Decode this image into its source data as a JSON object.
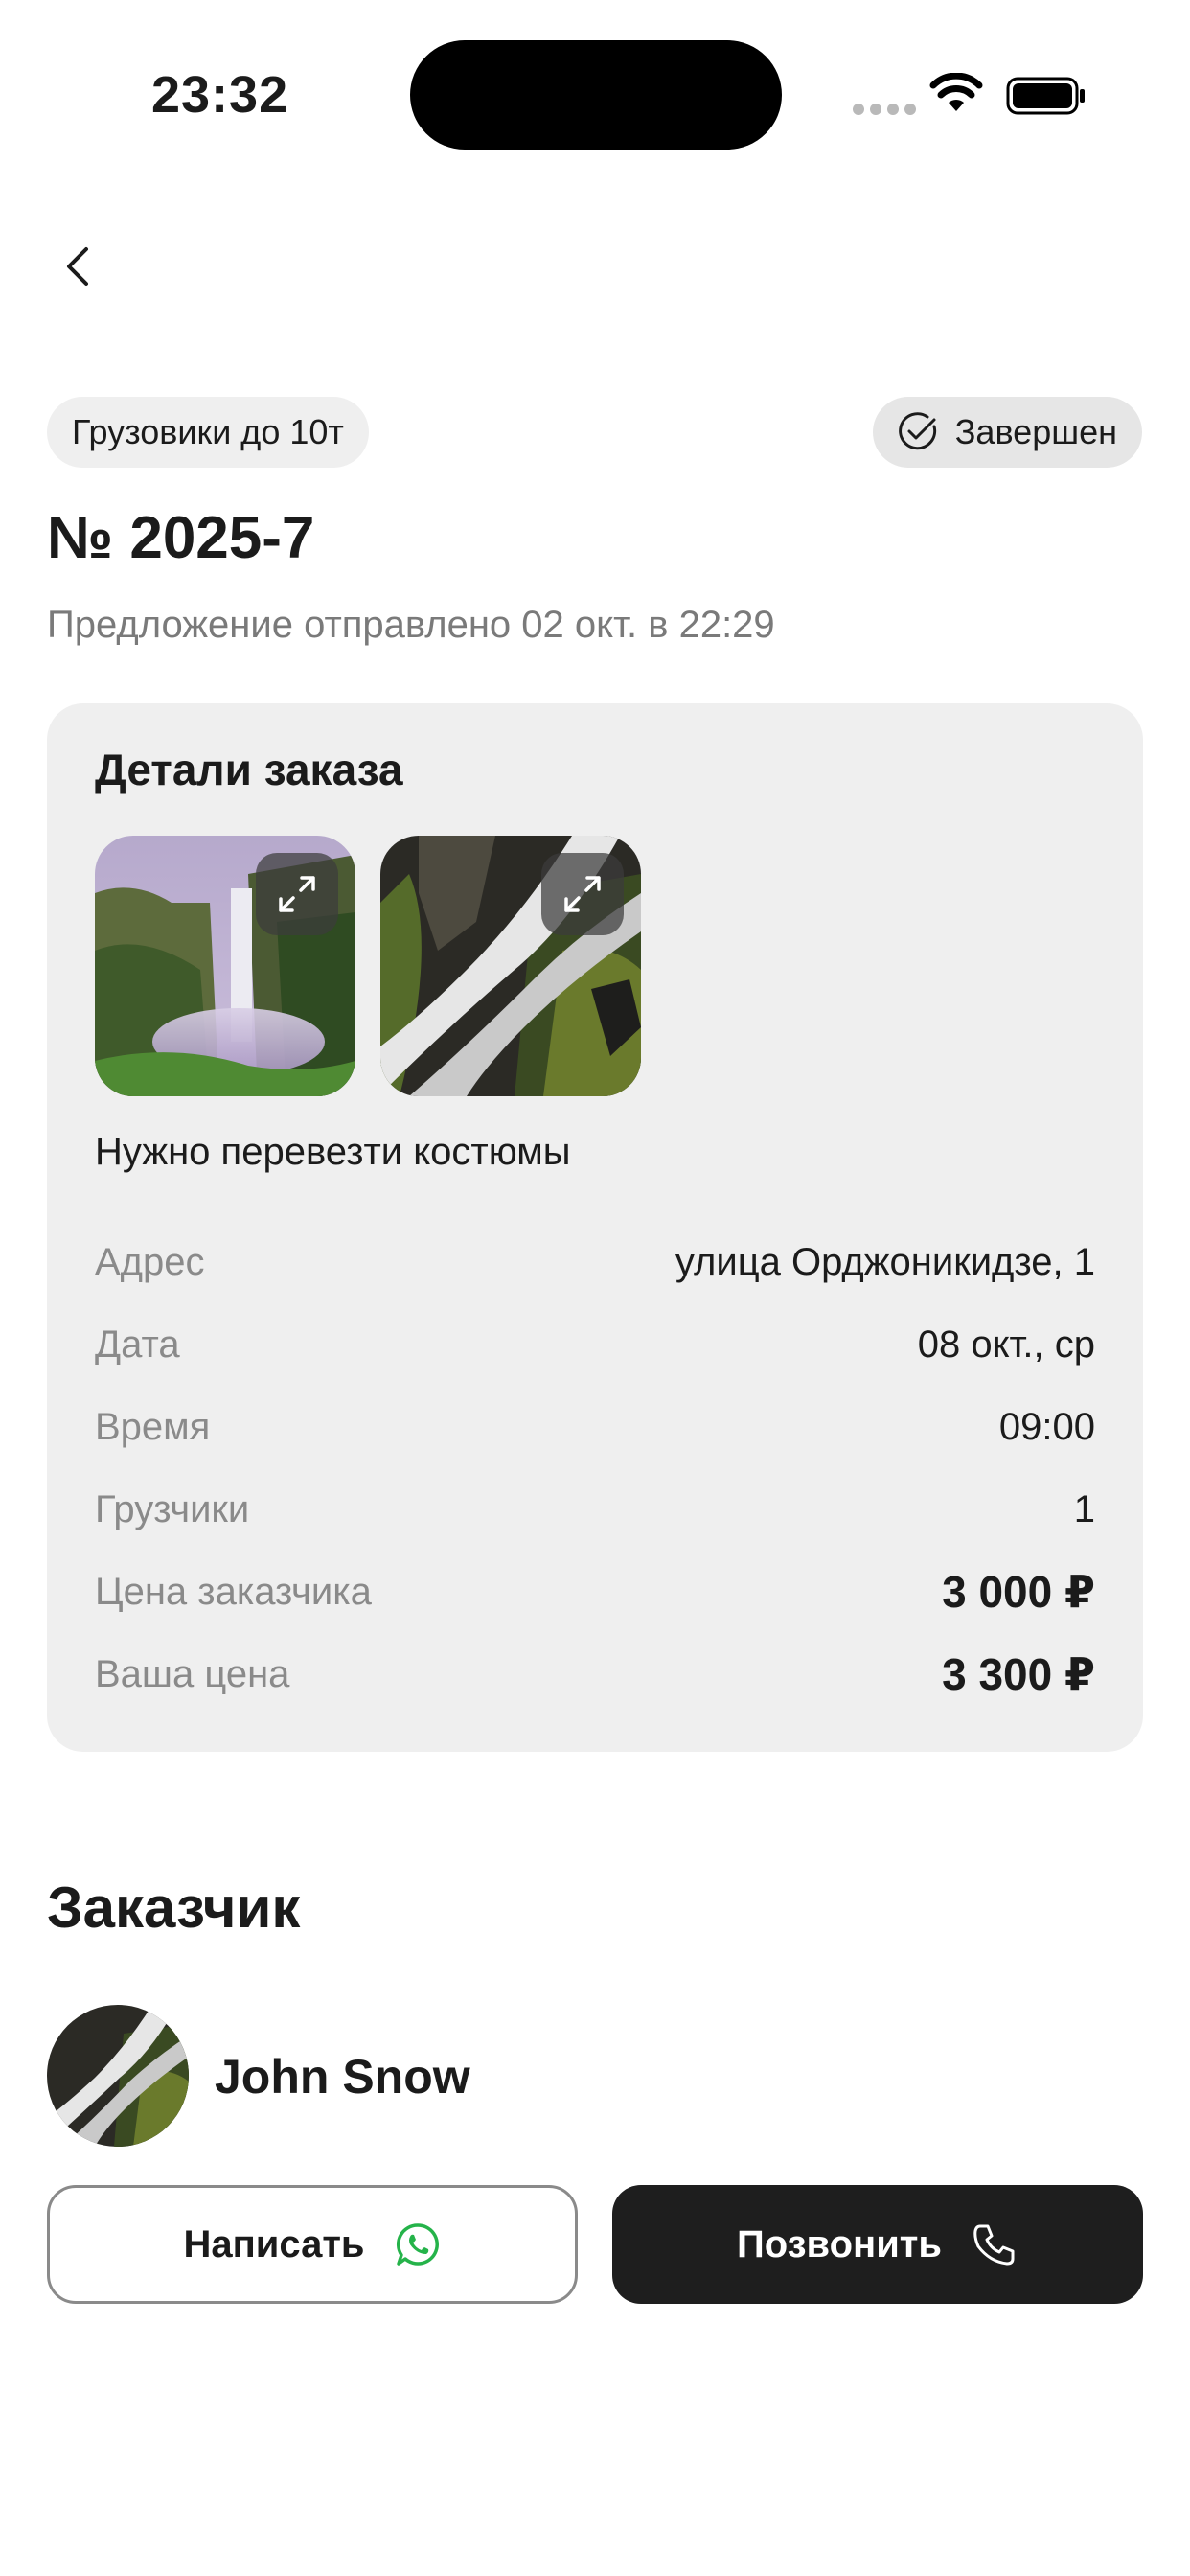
{
  "status_bar": {
    "time": "23:32"
  },
  "header": {
    "category": "Грузовики до 10т",
    "status": "Завершен"
  },
  "order": {
    "number": "№ 2025-7",
    "sent_text": "Предложение отправлено 02 окт. в 22:29"
  },
  "details": {
    "title": "Детали заказа",
    "description": "Нужно перевезти костюмы",
    "rows": [
      {
        "label": "Адрес",
        "value": "улица Орджоникидзе, 1"
      },
      {
        "label": "Дата",
        "value": "08 окт., ср"
      },
      {
        "label": "Время",
        "value": "09:00"
      },
      {
        "label": "Грузчики",
        "value": "1"
      },
      {
        "label": "Цена заказчика",
        "value": "3 000 ₽"
      },
      {
        "label": "Ваша цена",
        "value": "3 300 ₽"
      }
    ]
  },
  "customer": {
    "title": "Заказчик",
    "name": "John Snow"
  },
  "actions": {
    "write_label": "Написать",
    "call_label": "Позвонить"
  },
  "icons": {
    "back": "chevron-left-icon",
    "status": "check-circle-icon",
    "expand": "expand-icon",
    "whatsapp": "whatsapp-icon",
    "phone": "phone-icon"
  },
  "colors": {
    "accent_dark": "#1e1e1e",
    "whatsapp_green": "#25b34a",
    "card_bg": "#efefef"
  }
}
